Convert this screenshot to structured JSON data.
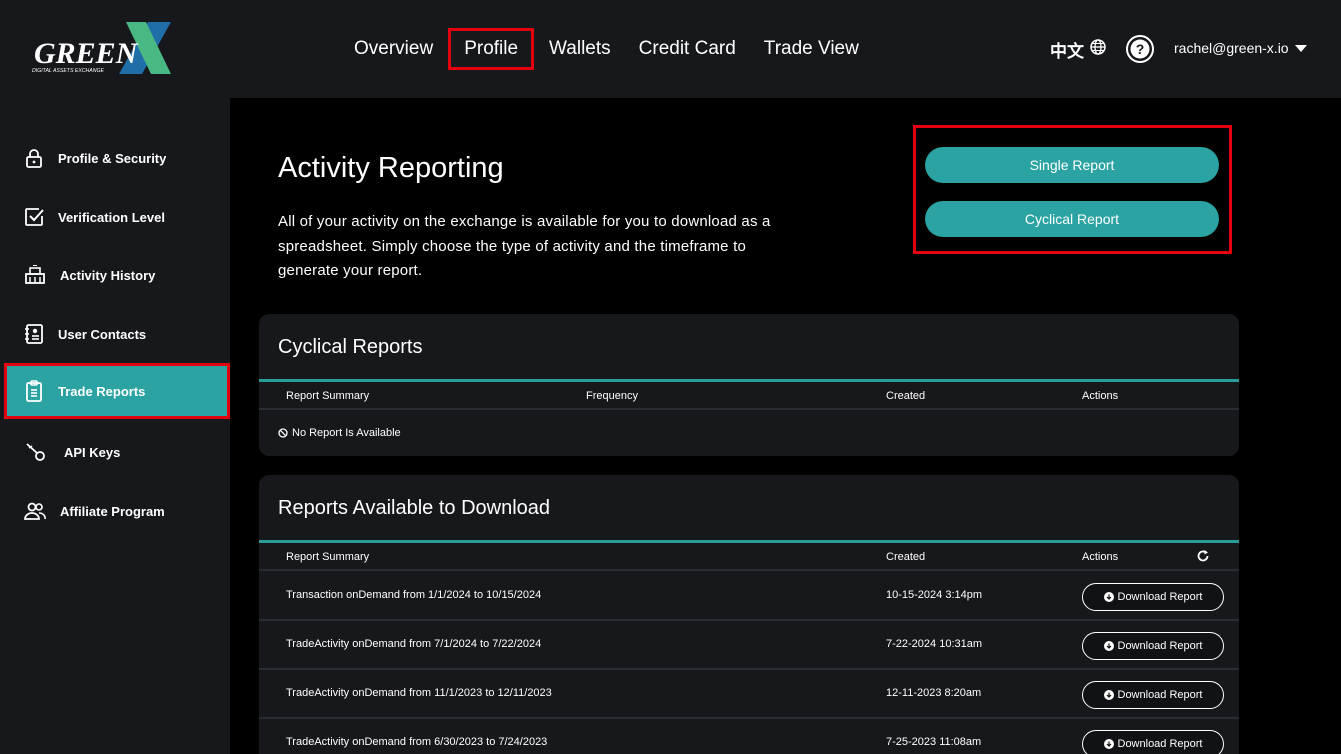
{
  "brand": {
    "logo_main": "GREEN",
    "logo_x": "X",
    "logo_tagline": "DIGITAL ASSETS EXCHANGE"
  },
  "nav": {
    "items": [
      {
        "label": "Overview"
      },
      {
        "label": "Profile",
        "active": true
      },
      {
        "label": "Wallets"
      },
      {
        "label": "Credit Card"
      },
      {
        "label": "Trade View"
      }
    ]
  },
  "header": {
    "language": "中文",
    "user_email": "rachel@green-x.io",
    "icons": [
      "globe-icon",
      "help-icon",
      "caret-down-icon"
    ]
  },
  "sidebar": {
    "items": [
      {
        "label": "Profile & Security",
        "icon": "lock-icon"
      },
      {
        "label": "Verification Level",
        "icon": "checkbox-icon"
      },
      {
        "label": "Activity History",
        "icon": "history-icon"
      },
      {
        "label": "User Contacts",
        "icon": "contacts-icon"
      },
      {
        "label": "Trade Reports",
        "icon": "clipboard-icon",
        "active": true
      },
      {
        "label": "API Keys",
        "icon": "key-icon"
      },
      {
        "label": "Affiliate Program",
        "icon": "users-icon"
      }
    ]
  },
  "page": {
    "title": "Activity Reporting",
    "description": "All of your activity on the exchange is available for you to download as a spreadsheet. Simply choose the type of activity and the timeframe to generate your report.",
    "single_report_label": "Single Report",
    "cyclical_report_label": "Cyclical Report"
  },
  "cyclical": {
    "title": "Cyclical Reports",
    "columns": [
      "Report Summary",
      "Frequency",
      "Created",
      "Actions"
    ],
    "empty_text": "No Report Is Available"
  },
  "downloads": {
    "title": "Reports Available to Download",
    "columns": [
      "Report Summary",
      "Created",
      "Actions"
    ],
    "button_label": "Download Report",
    "rows": [
      {
        "summary": "Transaction onDemand from 1/1/2024 to 10/15/2024",
        "created": "10-15-2024 3:14pm"
      },
      {
        "summary": "TradeActivity onDemand from 7/1/2024 to 7/22/2024",
        "created": "7-22-2024 10:31am"
      },
      {
        "summary": "TradeActivity onDemand from 11/1/2023 to 12/11/2023",
        "created": "12-11-2023 8:20am"
      },
      {
        "summary": "TradeActivity onDemand from 6/30/2023 to 7/24/2023",
        "created": "7-25-2023 11:08am"
      }
    ]
  },
  "colors": {
    "accent": "#2aa3a2",
    "highlight": "#e3000f",
    "panel": "#17181c",
    "background": "#000000"
  }
}
